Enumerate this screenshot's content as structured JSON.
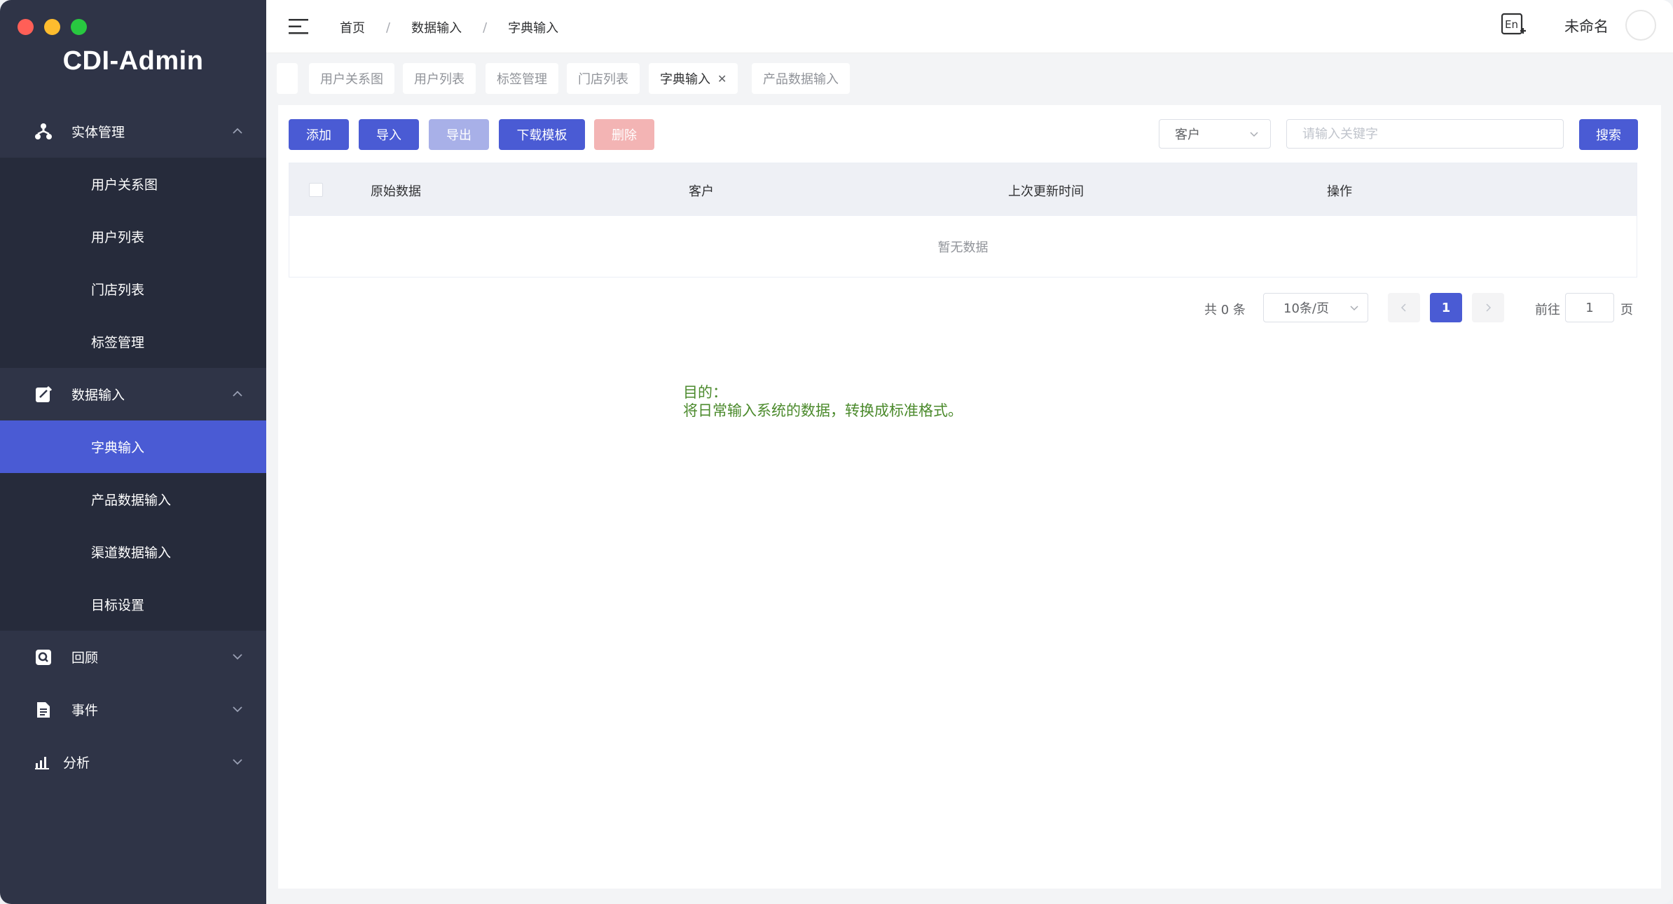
{
  "app": {
    "brand": "CDI-Admin"
  },
  "sidebar": {
    "groups": [
      {
        "label": "实体管理",
        "icon": "hierarchy-icon",
        "expanded": true,
        "items": [
          {
            "label": "用户关系图"
          },
          {
            "label": "用户列表"
          },
          {
            "label": "门店列表"
          },
          {
            "label": "标签管理"
          }
        ]
      },
      {
        "label": "数据输入",
        "icon": "edit-icon",
        "expanded": true,
        "items": [
          {
            "label": "字典输入",
            "active": true
          },
          {
            "label": "产品数据输入"
          },
          {
            "label": "渠道数据输入"
          },
          {
            "label": "目标设置"
          }
        ]
      },
      {
        "label": "回顾",
        "icon": "search-icon",
        "expanded": false
      },
      {
        "label": "事件",
        "icon": "document-icon",
        "expanded": false
      },
      {
        "label": "分析",
        "icon": "bar-chart-icon",
        "expanded": false
      }
    ]
  },
  "header": {
    "breadcrumb": [
      "首页",
      "数据输入",
      "字典输入"
    ],
    "username": "未命名",
    "lang_icon": "language-switch-icon"
  },
  "tabs": [
    {
      "label": "用户关系图"
    },
    {
      "label": "用户列表"
    },
    {
      "label": "标签管理"
    },
    {
      "label": "门店列表"
    },
    {
      "label": "字典输入",
      "active": true
    },
    {
      "label": "产品数据输入"
    }
  ],
  "toolbar": {
    "add": "添加",
    "import": "导入",
    "export": "导出",
    "download_template": "下载模板",
    "delete": "删除",
    "filter_select": "客户",
    "search_placeholder": "请输入关键字",
    "search": "搜索"
  },
  "table": {
    "columns": [
      "原始数据",
      "客户",
      "上次更新时间",
      "操作"
    ],
    "empty_text": "暂无数据"
  },
  "pagination": {
    "total": "共 0 条",
    "page_size": "10条/页",
    "current_page": "1",
    "goto_label": "前往",
    "goto_value": "1",
    "page_unit": "页"
  },
  "note": {
    "line1": "目的：",
    "line2": "将日常输入系统的数据，转换成标准格式。"
  },
  "colors": {
    "sidebar_bg": "#2f3447",
    "accent": "#4a5bd4",
    "note_text": "#4b8a2c"
  }
}
